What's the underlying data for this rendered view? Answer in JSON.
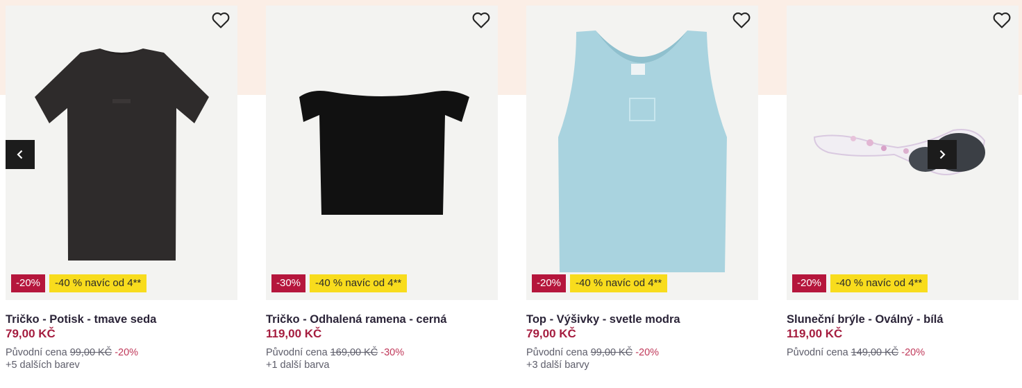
{
  "products": [
    {
      "title": "Tričko - Potisk - tmave seda",
      "price": "79,00 KČ",
      "orig_label": "Původní cena",
      "orig_price": "99,00 KČ",
      "orig_discount": "-20%",
      "colors": "+5 dalších barev",
      "badge_discount": "-20%",
      "badge_promo": "-40 % navíc od 4**",
      "image_icon": "dark-grey-tshirt-icon"
    },
    {
      "title": "Tričko - Odhalená ramena - cerná",
      "price": "119,00 KČ",
      "orig_label": "Původní cena",
      "orig_price": "169,00 KČ",
      "orig_discount": "-30%",
      "colors": "+1 další barva",
      "badge_discount": "-30%",
      "badge_promo": "-40 % navíc od 4**",
      "image_icon": "black-off-shoulder-top-icon"
    },
    {
      "title": "Top - Výšivky - svetle modra",
      "price": "79,00 KČ",
      "orig_label": "Původní cena",
      "orig_price": "99,00 KČ",
      "orig_discount": "-20%",
      "colors": "+3 další barvy",
      "badge_discount": "-20%",
      "badge_promo": "-40 % navíc od 4**",
      "image_icon": "light-blue-tank-top-icon"
    },
    {
      "title": "Sluneční brýle - Oválný - bílá",
      "price": "119,00 KČ",
      "orig_label": "Původní cena",
      "orig_price": "149,00 KČ",
      "orig_discount": "-20%",
      "colors": "",
      "badge_discount": "-20%",
      "badge_promo": "-40 % navíc od 4**",
      "image_icon": "sunglasses-icon"
    }
  ],
  "colors": {
    "price": "#a51d3f",
    "badge_discount": "#b5163c",
    "badge_promo": "#f8dc1d",
    "band": "#fbeee6"
  },
  "nav": {
    "prev_icon": "chevron-left-icon",
    "next_icon": "chevron-right-icon"
  }
}
